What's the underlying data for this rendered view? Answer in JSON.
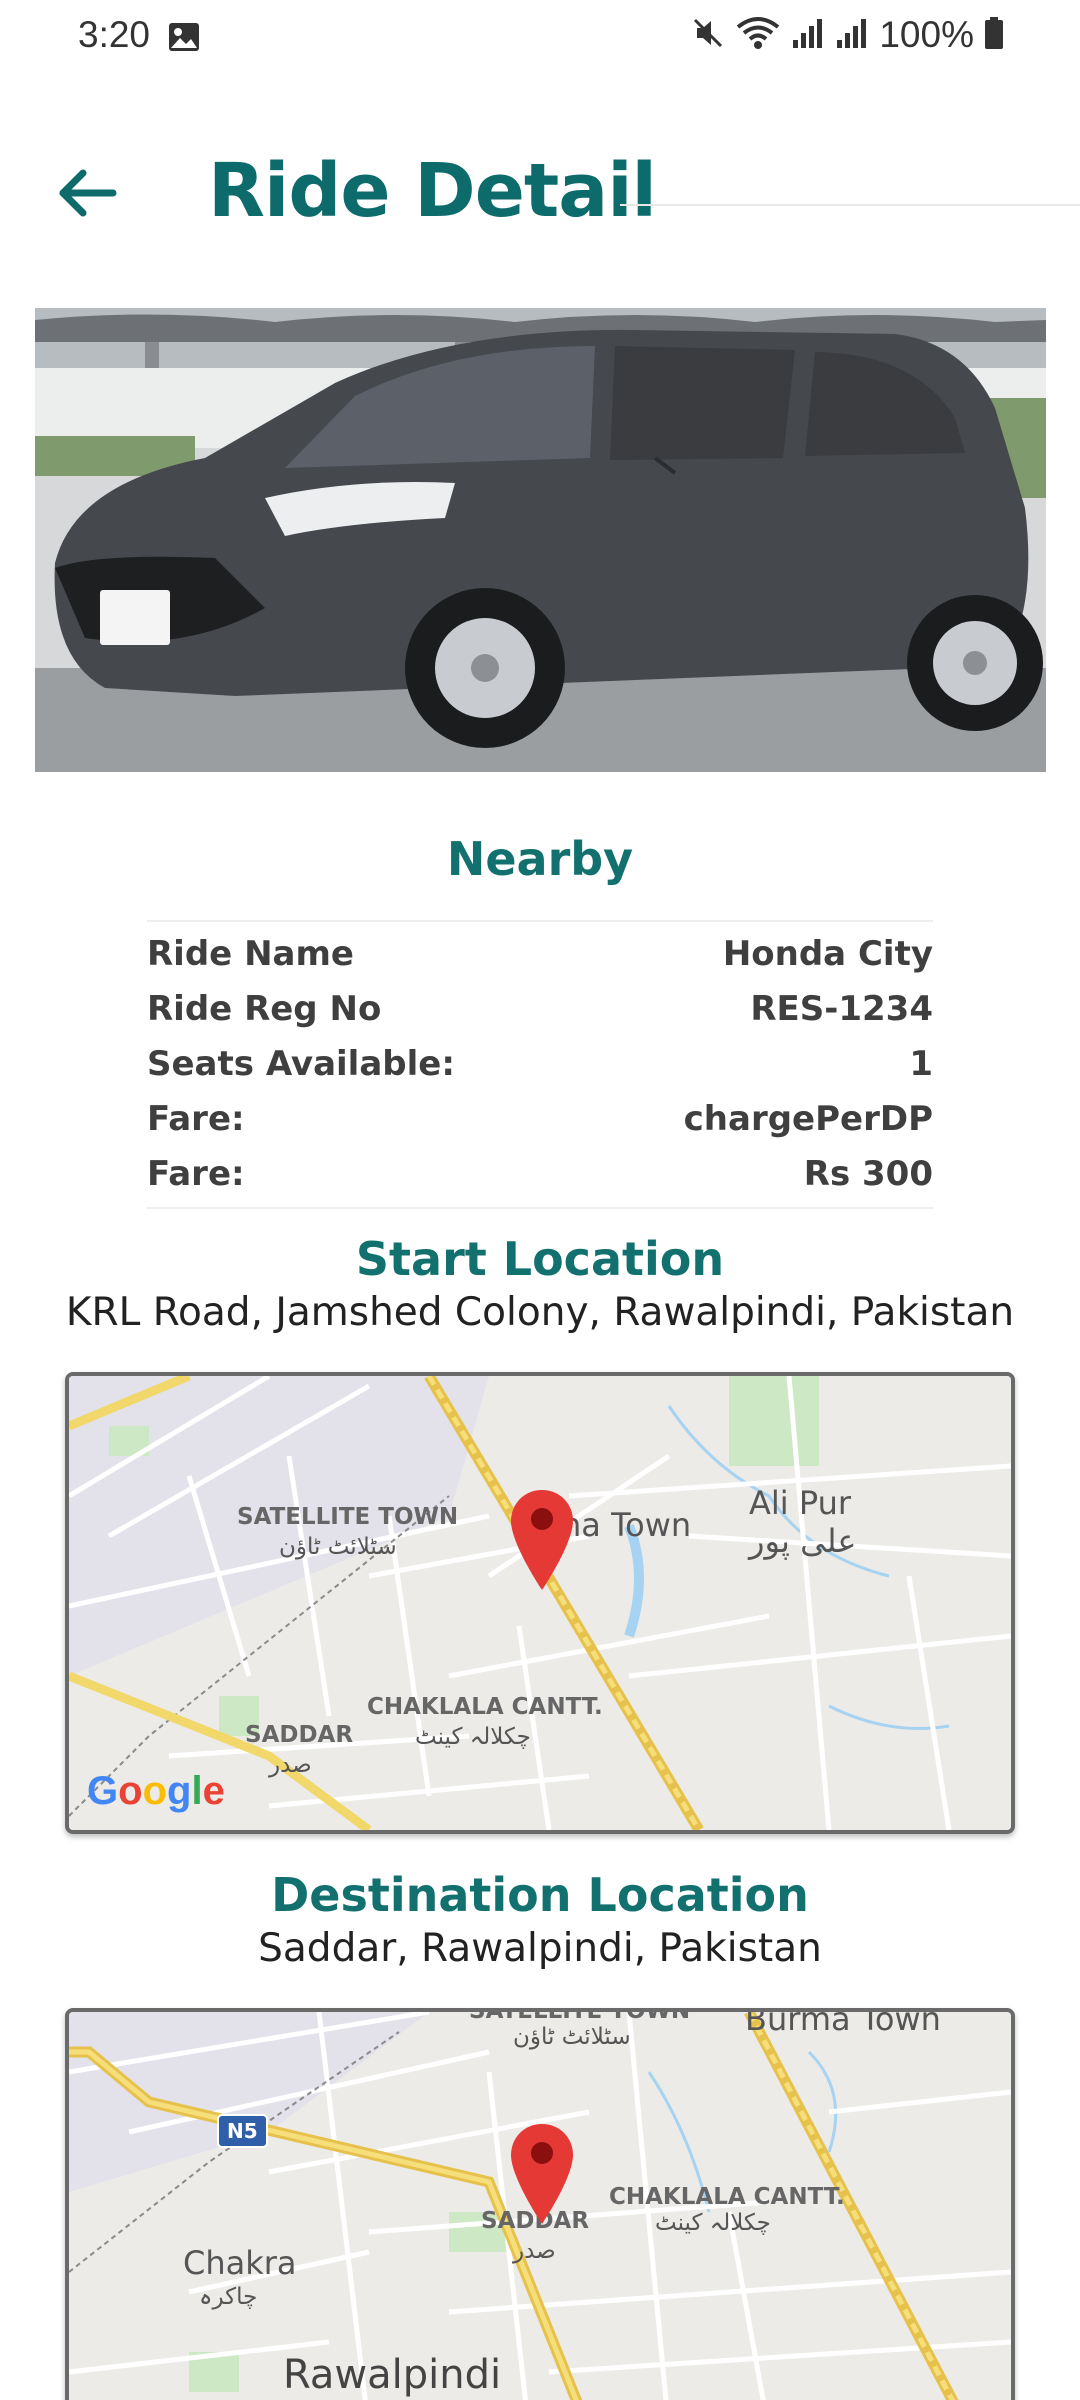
{
  "status_bar": {
    "time": "3:20",
    "battery": "100%",
    "icons": [
      "image-icon",
      "mute-icon",
      "wifi-icon",
      "signal-icon",
      "signal-icon",
      "battery-icon"
    ]
  },
  "header": {
    "title": "Ride Detail",
    "back_icon": "back-arrow-icon"
  },
  "colors": {
    "accent": "#0d6b6b",
    "map_pin": "#e53935"
  },
  "details": {
    "heading": "Nearby",
    "rows": [
      {
        "label": "Ride Name",
        "value": "Honda City"
      },
      {
        "label": "Ride Reg No",
        "value": "RES-1234"
      },
      {
        "label": "Seats Available:",
        "value": "1"
      },
      {
        "label": "Fare:",
        "value": "chargePerDP"
      },
      {
        "label": "Fare:",
        "value": "Rs 300"
      }
    ]
  },
  "start": {
    "heading": "Start Location",
    "address": "KRL Road, Jamshed Colony, Rawalpindi, Pakistan",
    "map": {
      "satellite_town": "SATELLITE TOWN",
      "satellite_town_urdu": "سٹلائٹ ٹاؤن",
      "burma_town": "na Town",
      "ali_pur": "Ali Pur",
      "ali_pur_urdu": "علی پور",
      "chaklala": "CHAKLALA CANTT.",
      "chaklala_urdu": "چکلالہ کینٹ",
      "saddar": "SADDAR",
      "saddar_urdu": "صدر",
      "logo": "Google"
    }
  },
  "destination": {
    "heading": "Destination Location",
    "address": "Saddar, Rawalpindi, Pakistan",
    "map": {
      "satellite_town": "SATELLITE TOWN",
      "satellite_town_urdu": "سٹلائٹ ٹاؤن",
      "burma_town": "Burma Town",
      "route": "N5",
      "chaklala": "CHAKLALA CANTT.",
      "chaklala_urdu": "چکلالہ کینٹ",
      "saddar": "SADDAR",
      "saddar_urdu": "صدر",
      "chakra": "Chakra",
      "chakra_urdu": "چاکرہ",
      "rawalpindi": "Rawalpindi"
    }
  }
}
